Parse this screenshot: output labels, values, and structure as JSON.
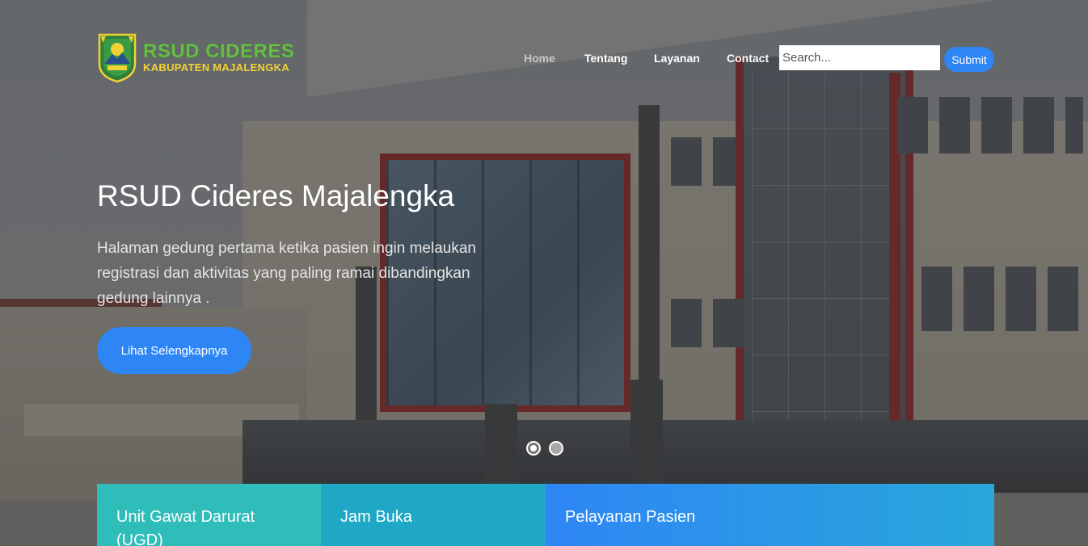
{
  "brand": {
    "title": "RSUD CIDERES",
    "subtitle": "KABUPATEN MAJALENGKA"
  },
  "nav": {
    "items": [
      {
        "label": "Home",
        "active": true
      },
      {
        "label": "Tentang",
        "active": false
      },
      {
        "label": "Layanan",
        "active": false
      },
      {
        "label": "Contact",
        "active": false
      }
    ]
  },
  "search": {
    "placeholder": "Search...",
    "value": "",
    "submit_label": "Submit"
  },
  "hero": {
    "title": "RSUD Cideres Majalengka",
    "description": "Halaman gedung pertama ketika pasien ingin melaukan registrasi dan aktivitas yang paling ramai dibandingkan gedung lainnya .",
    "cta_label": "Lihat Selengkapnya",
    "slides_total": 2,
    "active_slide": 1
  },
  "features": [
    {
      "title": "Unit Gawat Darurat (UGD)"
    },
    {
      "title": "Jam Buka"
    },
    {
      "title": "Pelayanan Pasien"
    }
  ],
  "colors": {
    "accent": "#2e86f5",
    "logo_green": "#6cc04a",
    "logo_yellow": "#f2d137",
    "box_teal": "#2fbdb9",
    "box_cyan": "#1ea8c6",
    "building_red": "#b02a2e"
  }
}
